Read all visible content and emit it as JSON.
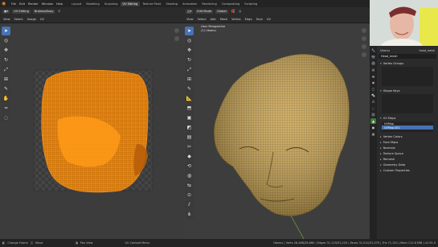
{
  "topbar": {
    "menus": [
      "File",
      "Edit",
      "Render",
      "Window",
      "Help"
    ],
    "tabs": [
      "Layout",
      "Modeling",
      "Sculpting",
      "UV Editing",
      "Texture Paint",
      "Shading",
      "Animation",
      "Rendering",
      "Compositing",
      "Scripting"
    ],
    "active_tab": "UV Editing"
  },
  "uv_editor": {
    "header_row1": {
      "mode": "UV Editing",
      "image_name": "BrakesuBuay"
    },
    "header_row2": [
      "View",
      "Select",
      "Image",
      "UV"
    ],
    "background": "#3c3c3c",
    "island_color": "#f08a10"
  },
  "viewport": {
    "header_row1": {
      "mode": "Edit Mode",
      "orientation": "Global"
    },
    "header_row2": [
      "View",
      "Select",
      "Add",
      "Mesh",
      "Vertex",
      "Edge",
      "Face",
      "UV"
    ],
    "overlay_title": "User Perspective",
    "overlay_subtitle": "(1) Ukomu",
    "mesh_color": "#c9a552"
  },
  "properties": {
    "breadcrumb_left": "Ukomu",
    "breadcrumb_right": "head_mesh",
    "mesh_name": "Head_mesh",
    "sections": {
      "vertex_groups": "Vertex Groups",
      "shape_keys": "Shape Keys",
      "uv_maps": "UV Maps",
      "vertex_colors": "Vertex Colors",
      "face_maps": "Face Maps",
      "normals": "Normals",
      "texture_space": "Texture Space",
      "remesh": "Remesh",
      "geometry_data": "Geometry Data",
      "custom_properties": "Custom Properties"
    },
    "uv_map_items": [
      "UVMap",
      "UVMap.001"
    ],
    "active_tab_color": "#3e7a3a"
  },
  "statusbar": {
    "left": [
      "Change Frame",
      "Move",
      "Pan View",
      "UV Context Menu"
    ],
    "stats": "Ukomu | Verts 28,488/28,660 | Edges 31,119/31,220 | Faces 31,014/31,075 | Tris 71,120 | Mem 112.6 MiB | v2.91.0"
  },
  "icons": {
    "tools": [
      "cursor-icon",
      "select-icon",
      "move-icon",
      "rotate-icon",
      "scale-icon",
      "transform-icon",
      "annotate-icon",
      "measure-icon",
      "grab-icon",
      "pinch-icon",
      "relax-icon",
      "rip-icon"
    ],
    "prop_tabs": [
      "tool-icon",
      "render-icon",
      "output-icon",
      "view-layer-icon",
      "scene-icon",
      "world-icon",
      "object-icon",
      "modifier-icon",
      "particles-icon",
      "physics-icon",
      "constraints-icon",
      "data-icon",
      "material-icon",
      "texture-icon"
    ]
  }
}
